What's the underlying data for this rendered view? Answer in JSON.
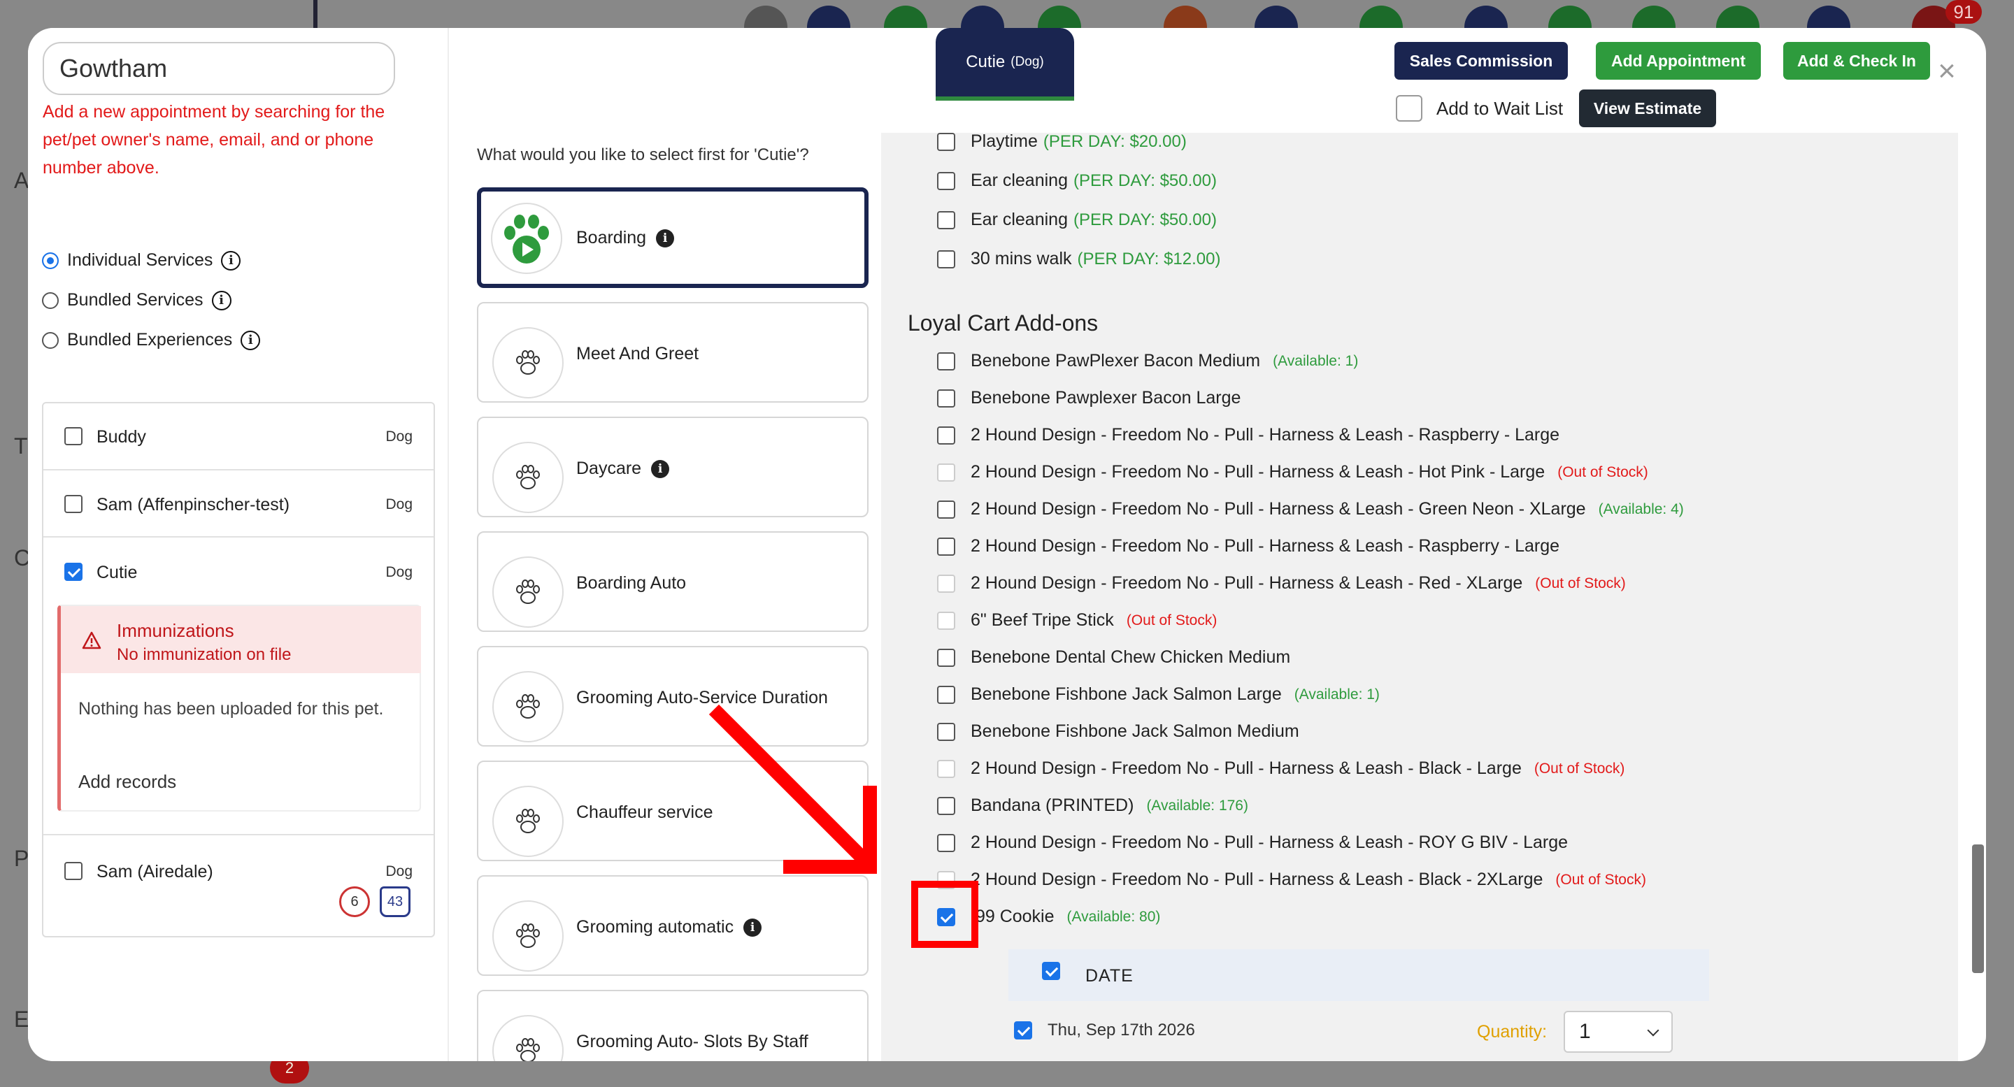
{
  "background": {
    "notification_count": "91",
    "bottom_counter": "2"
  },
  "left_panel": {
    "search_value": "Gowtham",
    "hint": "Add a new appointment by searching for the pet/pet owner's name, email, and or phone number above.",
    "service_types": [
      {
        "label": "Individual Services",
        "selected": true
      },
      {
        "label": "Bundled Services",
        "selected": false
      },
      {
        "label": "Bundled Experiences",
        "selected": false
      }
    ],
    "pets": [
      {
        "name": "Buddy",
        "type": "Dog",
        "checked": false
      },
      {
        "name": "Sam (Affenpinscher-test)",
        "type": "Dog",
        "checked": false
      },
      {
        "name": "Cutie",
        "type": "Dog",
        "checked": true
      },
      {
        "name": "Sam (Airedale)",
        "type": "Dog",
        "checked": false
      }
    ],
    "immunizations": {
      "title": "Immunizations",
      "subtitle": "No immunization on file",
      "body": "Nothing has been uploaded for this pet.",
      "add_records": "Add records"
    },
    "sam_icons": {
      "history_count": "6",
      "weight_value": "43"
    }
  },
  "middle_panel": {
    "question": "What would you like to select first for 'Cutie'?",
    "services": [
      {
        "label": "Boarding",
        "info": true,
        "active": true
      },
      {
        "label": "Meet And Greet",
        "info": false,
        "active": false
      },
      {
        "label": "Daycare",
        "info": true,
        "active": false
      },
      {
        "label": "Boarding Auto",
        "info": false,
        "active": false
      },
      {
        "label": "Grooming Auto-Service Duration",
        "info": false,
        "active": false
      },
      {
        "label": "Chauffeur service",
        "info": false,
        "active": false
      },
      {
        "label": "Grooming automatic",
        "info": true,
        "active": false
      },
      {
        "label": "Grooming Auto- Slots By Staff",
        "info": false,
        "active": false
      }
    ]
  },
  "header": {
    "pet_tab_name": "Cutie",
    "pet_tab_species": "(Dog)",
    "sales_commission": "Sales Commission",
    "add_appointment": "Add Appointment",
    "add_check_in": "Add & Check In",
    "add_wait_list": "Add to Wait List",
    "view_estimate": "View Estimate",
    "close": "×"
  },
  "addons": [
    {
      "name": "Playtime",
      "price": "(PER DAY: $20.00)"
    },
    {
      "name": "Ear cleaning",
      "price": "(PER DAY: $50.00)"
    },
    {
      "name": "Ear cleaning",
      "price": "(PER DAY: $50.00)"
    },
    {
      "name": "30 mins walk",
      "price": "(PER DAY: $12.00)"
    }
  ],
  "loyal_cart": {
    "title": "Loyal Cart Add-ons",
    "items": [
      {
        "name": "Benebone PawPlexer Bacon Medium",
        "status": "(Available: 1)",
        "kind": "avail",
        "disabled": false,
        "checked": false
      },
      {
        "name": "Benebone Pawplexer Bacon Large",
        "status": "",
        "kind": "",
        "disabled": false,
        "checked": false
      },
      {
        "name": "2 Hound Design - Freedom No - Pull - Harness & Leash - Raspberry - Large",
        "status": "",
        "kind": "",
        "disabled": false,
        "checked": false
      },
      {
        "name": "2 Hound Design - Freedom No - Pull - Harness & Leash - Hot Pink - Large",
        "status": "(Out of Stock)",
        "kind": "oos",
        "disabled": true,
        "checked": false
      },
      {
        "name": "2 Hound Design - Freedom No - Pull - Harness & Leash - Green Neon - XLarge",
        "status": "(Available: 4)",
        "kind": "avail",
        "disabled": false,
        "checked": false
      },
      {
        "name": "2 Hound Design - Freedom No - Pull - Harness & Leash - Raspberry - Large",
        "status": "",
        "kind": "",
        "disabled": false,
        "checked": false
      },
      {
        "name": "2 Hound Design - Freedom No - Pull - Harness & Leash - Red - XLarge",
        "status": "(Out of Stock)",
        "kind": "oos",
        "disabled": true,
        "checked": false
      },
      {
        "name": "6\" Beef Tripe Stick",
        "status": "(Out of Stock)",
        "kind": "oos",
        "disabled": true,
        "checked": false
      },
      {
        "name": "Benebone Dental Chew Chicken Medium",
        "status": "",
        "kind": "",
        "disabled": false,
        "checked": false
      },
      {
        "name": "Benebone Fishbone Jack Salmon Large",
        "status": "(Available: 1)",
        "kind": "avail",
        "disabled": false,
        "checked": false
      },
      {
        "name": "Benebone Fishbone Jack Salmon Medium",
        "status": "",
        "kind": "",
        "disabled": false,
        "checked": false
      },
      {
        "name": "2 Hound Design - Freedom No - Pull - Harness & Leash - Black - Large",
        "status": "(Out of Stock)",
        "kind": "oos",
        "disabled": true,
        "checked": false
      },
      {
        "name": "Bandana (PRINTED)",
        "status": "(Available: 176)",
        "kind": "avail",
        "disabled": false,
        "checked": false
      },
      {
        "name": "2 Hound Design - Freedom No - Pull - Harness & Leash - ROY G BIV - Large",
        "status": "",
        "kind": "",
        "disabled": false,
        "checked": false
      },
      {
        "name": "2 Hound Design - Freedom No - Pull - Harness & Leash - Black - 2XLarge",
        "status": "(Out of Stock)",
        "kind": "oos",
        "disabled": true,
        "checked": false
      },
      {
        "name": ".99 Cookie",
        "status": "(Available: 80)",
        "kind": "avail",
        "disabled": false,
        "checked": true
      }
    ]
  },
  "date_section": {
    "header": "DATE",
    "date": "Thu, Sep 17th 2026",
    "quantity_label": "Quantity:",
    "quantity_value": "1"
  },
  "colors": {
    "navy": "#1a2550",
    "green": "#2e9b3d",
    "red": "#e21a1a",
    "check_blue": "#1a73e8"
  }
}
